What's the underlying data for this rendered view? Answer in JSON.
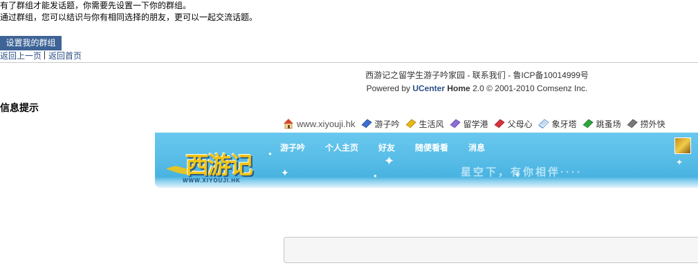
{
  "message": {
    "line1": "有了群组才能发话题，你需要先设置一下你的群组。",
    "line2": "通过群组，您可以结识与你有相同选择的朋友，更可以一起交流话题。"
  },
  "setup_button": "设置我的群组",
  "links": {
    "back": "返回上一页",
    "home": "返回首页"
  },
  "footer": {
    "site": "西游记之留学生游子吟家园",
    "contact": "联系我们",
    "icp": "鲁ICP备10014999号",
    "powered_by": "Powered by",
    "ucenter": "UCenter",
    "home": "Home",
    "version": "2.0",
    "copyright": "© 2001-2010 Comsenz Inc."
  },
  "info_title": "信息提示",
  "site_nav": {
    "home_url": "www.xiyouji.hk",
    "items": [
      {
        "label": "游子吟",
        "icon": "blue-book-icon",
        "color": "#3c6fd0"
      },
      {
        "label": "生活风",
        "icon": "yellow-book-icon",
        "color": "#e9b819"
      },
      {
        "label": "留学港",
        "icon": "purple-book-icon",
        "color": "#8b6fd6"
      },
      {
        "label": "父母心",
        "icon": "red-book-icon",
        "color": "#d8333a"
      },
      {
        "label": "象牙塔",
        "icon": "notebook-icon",
        "color": "#6aa0d8"
      },
      {
        "label": "跳蚤场",
        "icon": "green-book-icon",
        "color": "#2fa63a"
      },
      {
        "label": "捞外快",
        "icon": "gray-book-icon",
        "color": "#7a7a7a"
      }
    ]
  },
  "banner": {
    "logo_text": "西游记",
    "logo_url": "WWW.XIYOUJI.HK",
    "nav": [
      "游子吟",
      "个人主页",
      "好友",
      "随便看看",
      "消息"
    ],
    "slogan": "星空下，有你相伴····"
  },
  "colors": {
    "button": "#3d6397",
    "banner": "#55bbe6",
    "link": "#2b4f86"
  }
}
